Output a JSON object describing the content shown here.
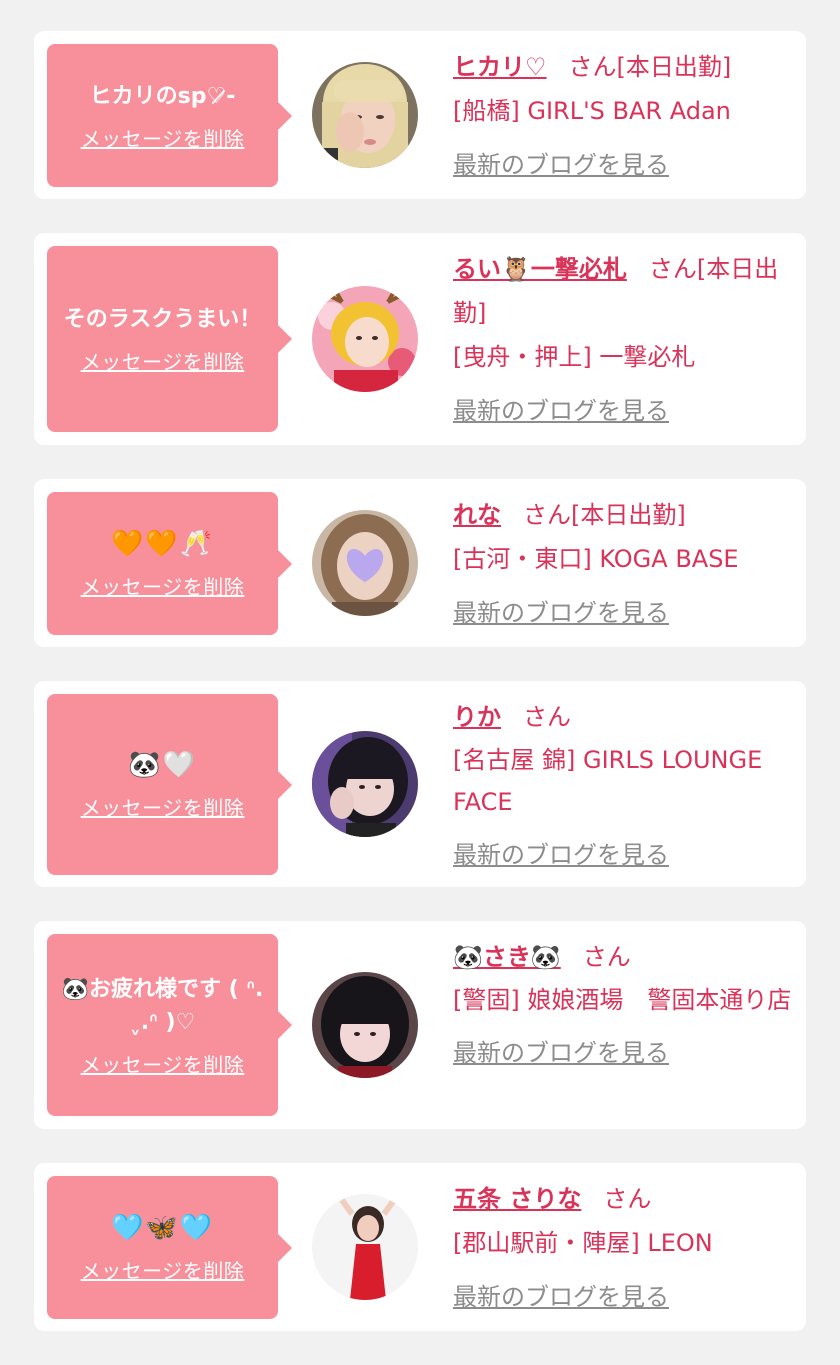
{
  "common": {
    "delete_label": "メッセージを削除",
    "blog_label": "最新のブログを見る",
    "honorific": "さん"
  },
  "colors": {
    "background": "#f1f1f1",
    "card": "#ffffff",
    "bubble": "#f7909b",
    "accent": "#d9335a",
    "link_gray": "#8c8c8c"
  },
  "cards": [
    {
      "message": "ヒカリのsp♡̷̷-",
      "name": "ヒカリ♡",
      "status": "[本日出勤]",
      "shop": "[船橋] GIRL'S BAR Adan",
      "avatar_icon": "woman-blonde-photo"
    },
    {
      "message": "そのラスクうまい！",
      "name": "るい🦉一撃必札",
      "status": "[本日出勤]",
      "shop": "[曳舟・押上] 一撃必札",
      "avatar_icon": "woman-reindeer-photo"
    },
    {
      "message": "🧡🧡🥂",
      "name": "れな",
      "status": "[本日出勤]",
      "shop": "[古河・東口] KOGA BASE",
      "avatar_icon": "woman-heart-sticker-photo"
    },
    {
      "message": "🐼🤍",
      "name": "りか",
      "status": "",
      "shop": "[名古屋 錦] GIRLS LOUNGE FACE",
      "avatar_icon": "woman-dark-hair-photo"
    },
    {
      "message": "🐼お疲れ様です ( ᐢ.ˬ.ᐢ )♡",
      "name": "🐼さき🐼",
      "status": "",
      "shop": "[警固] 娘娘酒場　警固本通り店",
      "avatar_icon": "woman-black-bangs-photo"
    },
    {
      "message": "🩵🦋🩵",
      "name": "五条 さりな",
      "status": "",
      "shop": "[郡山駅前・陣屋] LEON",
      "avatar_icon": "woman-red-dress-photo"
    }
  ]
}
